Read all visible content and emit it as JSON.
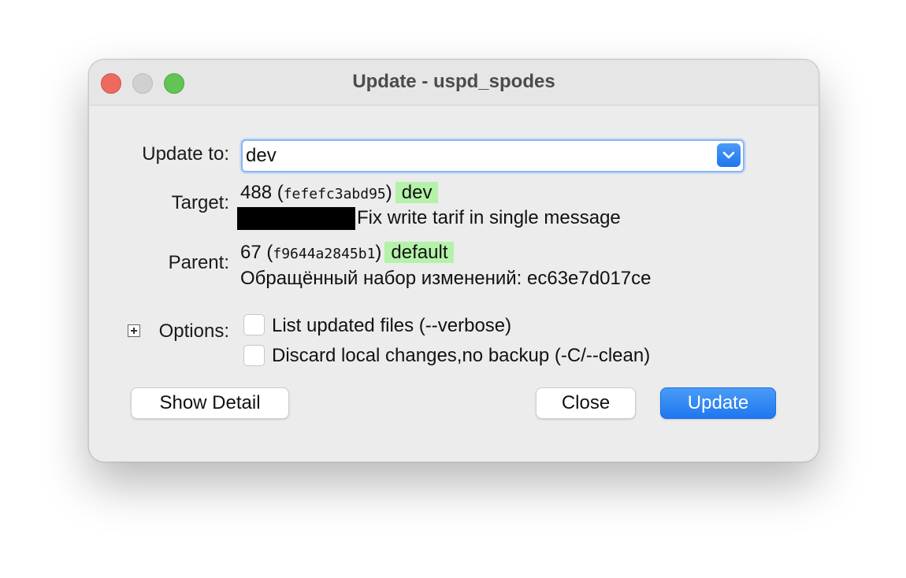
{
  "window": {
    "title": "Update - uspd_spodes"
  },
  "update_to": {
    "label": "Update to:",
    "value": "dev"
  },
  "target": {
    "label": "Target:",
    "rev": "488",
    "open_paren": "(",
    "hash": "fefefc3abd95",
    "close_paren": ")",
    "branch": "dev",
    "message": "Fix write tarif in single message"
  },
  "parent": {
    "label": "Parent:",
    "rev": "67",
    "open_paren": "(",
    "hash": "f9644a2845b1",
    "close_paren": ")",
    "branch": "default",
    "message": "Обращённый набор изменений: ec63e7d017ce"
  },
  "options": {
    "label": "Options:",
    "verbose_label": "List updated files (--verbose)",
    "clean_label": "Discard local changes,no backup (-C/--clean)"
  },
  "buttons": {
    "show_detail": "Show Detail",
    "close": "Close",
    "update": "Update"
  },
  "colors": {
    "tag_bg": "#b4f2a9",
    "accent": "#1f77ef",
    "close_red": "#ed6a5e",
    "zoom_green": "#61c454"
  }
}
